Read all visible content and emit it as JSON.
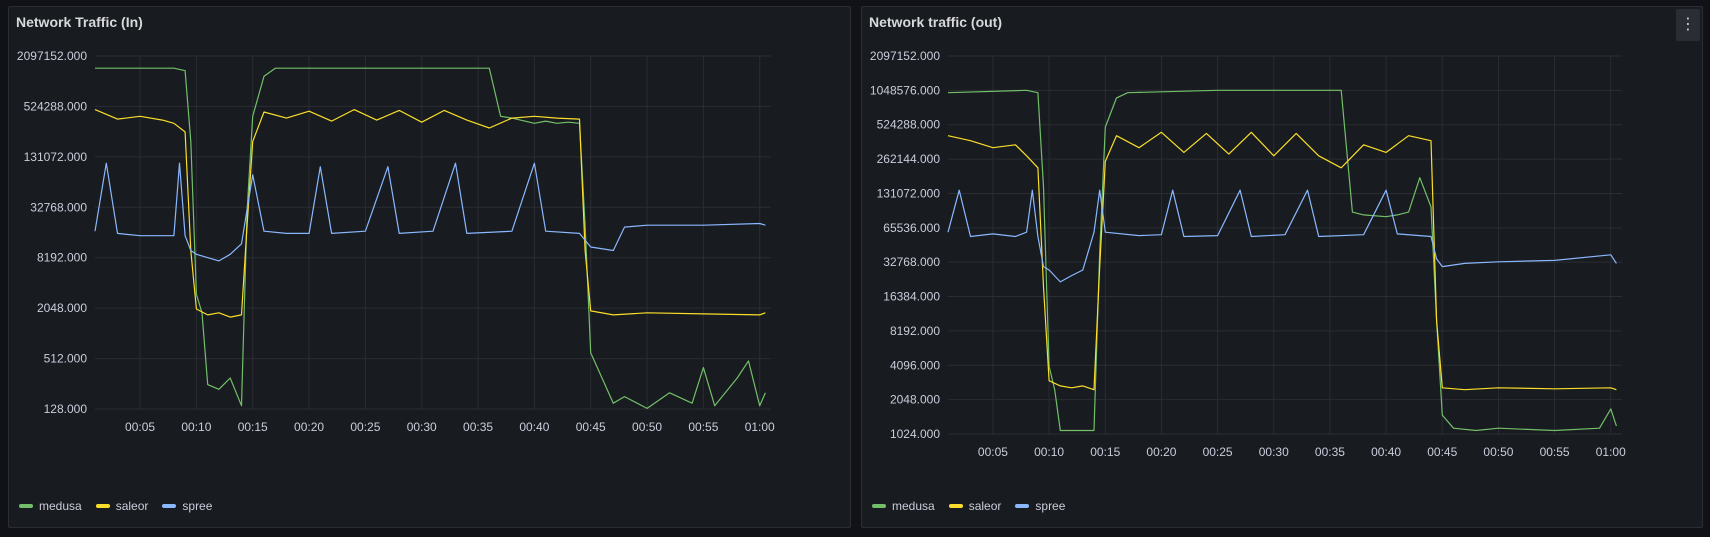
{
  "panels": [
    {
      "title": "Network Traffic (In)",
      "y_ticks": [
        "2097152.000",
        "524288.000",
        "131072.000",
        "32768.000",
        "8192.000",
        "2048.000",
        "512.000",
        "128.000"
      ],
      "x_ticks": [
        "00:05",
        "00:10",
        "00:15",
        "00:20",
        "00:25",
        "00:30",
        "00:35",
        "00:40",
        "00:45",
        "00:50",
        "00:55",
        "01:00"
      ],
      "legend": [
        "medusa",
        "saleor",
        "spree"
      ]
    },
    {
      "title": "Network traffic (out)",
      "menu_icon": "⋮",
      "y_ticks": [
        "2097152.000",
        "1048576.000",
        "524288.000",
        "262144.000",
        "131072.000",
        "65536.000",
        "32768.000",
        "16384.000",
        "8192.000",
        "4096.000",
        "2048.000",
        "1024.000"
      ],
      "x_ticks": [
        "00:05",
        "00:10",
        "00:15",
        "00:20",
        "00:25",
        "00:30",
        "00:35",
        "00:40",
        "00:45",
        "00:50",
        "00:55",
        "01:00"
      ],
      "legend": [
        "medusa",
        "saleor",
        "spree"
      ]
    }
  ],
  "colors": {
    "medusa": "#73bf69",
    "saleor": "#fade2a",
    "spree": "#8ab8ff",
    "grid": "#2a2d33",
    "panel_bg": "#181b1f"
  },
  "chart_data": [
    {
      "type": "line",
      "title": "Network Traffic (In)",
      "scale": "log2",
      "ylim": [
        128,
        2097152
      ],
      "xlim": [
        "00:01",
        "01:01"
      ],
      "series": [
        {
          "name": "medusa",
          "points": [
            [
              "00:01",
              1500000
            ],
            [
              "00:08",
              1500000
            ],
            [
              "00:09",
              1400000
            ],
            [
              "00:09:30",
              200000
            ],
            [
              "00:10",
              3000
            ],
            [
              "00:10:30",
              1800
            ],
            [
              "00:11",
              250
            ],
            [
              "00:12",
              220
            ],
            [
              "00:13",
              300
            ],
            [
              "00:14",
              140
            ],
            [
              "00:14:30",
              30000
            ],
            [
              "00:15",
              400000
            ],
            [
              "00:16",
              1200000
            ],
            [
              "00:17",
              1500000
            ],
            [
              "00:25",
              1500000
            ],
            [
              "00:30",
              1500000
            ],
            [
              "00:36",
              1500000
            ],
            [
              "00:37",
              400000
            ],
            [
              "00:38",
              380000
            ],
            [
              "00:40",
              330000
            ],
            [
              "00:41",
              350000
            ],
            [
              "00:42",
              330000
            ],
            [
              "00:43",
              340000
            ],
            [
              "00:44",
              330000
            ],
            [
              "00:44:30",
              20000
            ],
            [
              "00:45",
              600
            ],
            [
              "00:46",
              300
            ],
            [
              "00:47",
              150
            ],
            [
              "00:48",
              180
            ],
            [
              "00:50",
              130
            ],
            [
              "00:52",
              200
            ],
            [
              "00:54",
              150
            ],
            [
              "00:55",
              400
            ],
            [
              "00:56",
              140
            ],
            [
              "00:58",
              300
            ],
            [
              "00:59",
              480
            ],
            [
              "01:00",
              140
            ],
            [
              "01:00:30",
              200
            ]
          ]
        },
        {
          "name": "saleor",
          "points": [
            [
              "00:01",
              480000
            ],
            [
              "00:03",
              370000
            ],
            [
              "00:05",
              400000
            ],
            [
              "00:07",
              360000
            ],
            [
              "00:08",
              330000
            ],
            [
              "00:09",
              260000
            ],
            [
              "00:09:30",
              10000
            ],
            [
              "00:10",
              2000
            ],
            [
              "00:11",
              1700
            ],
            [
              "00:12",
              1800
            ],
            [
              "00:13",
              1600
            ],
            [
              "00:14",
              1700
            ],
            [
              "00:14:30",
              20000
            ],
            [
              "00:15",
              200000
            ],
            [
              "00:16",
              450000
            ],
            [
              "00:18",
              380000
            ],
            [
              "00:20",
              460000
            ],
            [
              "00:22",
              350000
            ],
            [
              "00:24",
              480000
            ],
            [
              "00:26",
              360000
            ],
            [
              "00:28",
              470000
            ],
            [
              "00:30",
              340000
            ],
            [
              "00:32",
              470000
            ],
            [
              "00:34",
              360000
            ],
            [
              "00:36",
              290000
            ],
            [
              "00:38",
              380000
            ],
            [
              "00:40",
              400000
            ],
            [
              "00:42",
              380000
            ],
            [
              "00:44",
              370000
            ],
            [
              "00:44:30",
              10000
            ],
            [
              "00:45",
              1900
            ],
            [
              "00:47",
              1700
            ],
            [
              "00:50",
              1800
            ],
            [
              "00:55",
              1750
            ],
            [
              "01:00",
              1700
            ],
            [
              "01:00:30",
              1800
            ]
          ]
        },
        {
          "name": "spree",
          "points": [
            [
              "00:01",
              17000
            ],
            [
              "00:02",
              110000
            ],
            [
              "00:03",
              16000
            ],
            [
              "00:05",
              15000
            ],
            [
              "00:08",
              15000
            ],
            [
              "00:08:30",
              110000
            ],
            [
              "00:09",
              15000
            ],
            [
              "00:09:30",
              10000
            ],
            [
              "00:10",
              9000
            ],
            [
              "00:12",
              7500
            ],
            [
              "00:13",
              9000
            ],
            [
              "00:14",
              12000
            ],
            [
              "00:15",
              80000
            ],
            [
              "00:16",
              17000
            ],
            [
              "00:18",
              16000
            ],
            [
              "00:20",
              16000
            ],
            [
              "00:21",
              100000
            ],
            [
              "00:22",
              16000
            ],
            [
              "00:25",
              17000
            ],
            [
              "00:27",
              100000
            ],
            [
              "00:28",
              16000
            ],
            [
              "00:31",
              17000
            ],
            [
              "00:33",
              110000
            ],
            [
              "00:34",
              16000
            ],
            [
              "00:38",
              17000
            ],
            [
              "00:40",
              110000
            ],
            [
              "00:41",
              17000
            ],
            [
              "00:44",
              16000
            ],
            [
              "00:45",
              11000
            ],
            [
              "00:47",
              10000
            ],
            [
              "00:48",
              19000
            ],
            [
              "00:50",
              20000
            ],
            [
              "00:55",
              20000
            ],
            [
              "01:00",
              21000
            ],
            [
              "01:00:30",
              20000
            ]
          ]
        }
      ]
    },
    {
      "type": "line",
      "title": "Network traffic (out)",
      "scale": "log2",
      "ylim": [
        1024,
        2097152
      ],
      "xlim": [
        "00:01",
        "01:01"
      ],
      "series": [
        {
          "name": "medusa",
          "points": [
            [
              "00:01",
              1000000
            ],
            [
              "00:08",
              1050000
            ],
            [
              "00:09",
              1000000
            ],
            [
              "00:09:30",
              150000
            ],
            [
              "00:10",
              4000
            ],
            [
              "00:10:30",
              2500
            ],
            [
              "00:11",
              1100
            ],
            [
              "00:13",
              1100
            ],
            [
              "00:14",
              1100
            ],
            [
              "00:14:30",
              40000
            ],
            [
              "00:15",
              500000
            ],
            [
              "00:16",
              900000
            ],
            [
              "00:17",
              1000000
            ],
            [
              "00:25",
              1050000
            ],
            [
              "00:30",
              1050000
            ],
            [
              "00:36",
              1050000
            ],
            [
              "00:37",
              90000
            ],
            [
              "00:38",
              85000
            ],
            [
              "00:40",
              82000
            ],
            [
              "00:41",
              85000
            ],
            [
              "00:42",
              90000
            ],
            [
              "00:43",
              180000
            ],
            [
              "00:44",
              100000
            ],
            [
              "00:44:30",
              10000
            ],
            [
              "00:45",
              1500
            ],
            [
              "00:46",
              1150
            ],
            [
              "00:48",
              1100
            ],
            [
              "00:50",
              1150
            ],
            [
              "00:55",
              1100
            ],
            [
              "00:59",
              1150
            ],
            [
              "01:00",
              1700
            ],
            [
              "01:00:30",
              1200
            ]
          ]
        },
        {
          "name": "saleor",
          "points": [
            [
              "00:01",
              420000
            ],
            [
              "00:03",
              380000
            ],
            [
              "00:05",
              330000
            ],
            [
              "00:07",
              350000
            ],
            [
              "00:08",
              280000
            ],
            [
              "00:09",
              220000
            ],
            [
              "00:09:30",
              20000
            ],
            [
              "00:10",
              3000
            ],
            [
              "00:11",
              2700
            ],
            [
              "00:12",
              2600
            ],
            [
              "00:13",
              2700
            ],
            [
              "00:14",
              2500
            ],
            [
              "00:14:30",
              30000
            ],
            [
              "00:15",
              250000
            ],
            [
              "00:16",
              420000
            ],
            [
              "00:18",
              330000
            ],
            [
              "00:20",
              450000
            ],
            [
              "00:22",
              300000
            ],
            [
              "00:24",
              440000
            ],
            [
              "00:26",
              290000
            ],
            [
              "00:28",
              450000
            ],
            [
              "00:30",
              280000
            ],
            [
              "00:32",
              440000
            ],
            [
              "00:34",
              280000
            ],
            [
              "00:36",
              220000
            ],
            [
              "00:38",
              350000
            ],
            [
              "00:40",
              300000
            ],
            [
              "00:42",
              420000
            ],
            [
              "00:44",
              380000
            ],
            [
              "00:44:30",
              10000
            ],
            [
              "00:45",
              2600
            ],
            [
              "00:47",
              2500
            ],
            [
              "00:50",
              2600
            ],
            [
              "00:55",
              2550
            ],
            [
              "01:00",
              2600
            ],
            [
              "01:00:30",
              2500
            ]
          ]
        },
        {
          "name": "spree",
          "points": [
            [
              "00:01",
              60000
            ],
            [
              "00:02",
              140000
            ],
            [
              "00:03",
              55000
            ],
            [
              "00:05",
              58000
            ],
            [
              "00:07",
              55000
            ],
            [
              "00:08",
              60000
            ],
            [
              "00:08:30",
              140000
            ],
            [
              "00:09",
              55000
            ],
            [
              "00:09:30",
              30000
            ],
            [
              "00:10",
              28000
            ],
            [
              "00:11",
              22000
            ],
            [
              "00:12",
              25000
            ],
            [
              "00:13",
              28000
            ],
            [
              "00:14",
              60000
            ],
            [
              "00:14:30",
              140000
            ],
            [
              "00:15",
              60000
            ],
            [
              "00:18",
              56000
            ],
            [
              "00:20",
              57000
            ],
            [
              "00:21",
              140000
            ],
            [
              "00:22",
              55000
            ],
            [
              "00:25",
              56000
            ],
            [
              "00:27",
              140000
            ],
            [
              "00:28",
              55000
            ],
            [
              "00:31",
              57000
            ],
            [
              "00:33",
              140000
            ],
            [
              "00:34",
              55000
            ],
            [
              "00:38",
              57000
            ],
            [
              "00:40",
              140000
            ],
            [
              "00:41",
              58000
            ],
            [
              "00:44",
              55000
            ],
            [
              "00:44:30",
              35000
            ],
            [
              "00:45",
              30000
            ],
            [
              "00:47",
              32000
            ],
            [
              "00:50",
              33000
            ],
            [
              "00:55",
              34000
            ],
            [
              "01:00",
              38000
            ],
            [
              "01:00:30",
              32000
            ]
          ]
        }
      ]
    }
  ]
}
